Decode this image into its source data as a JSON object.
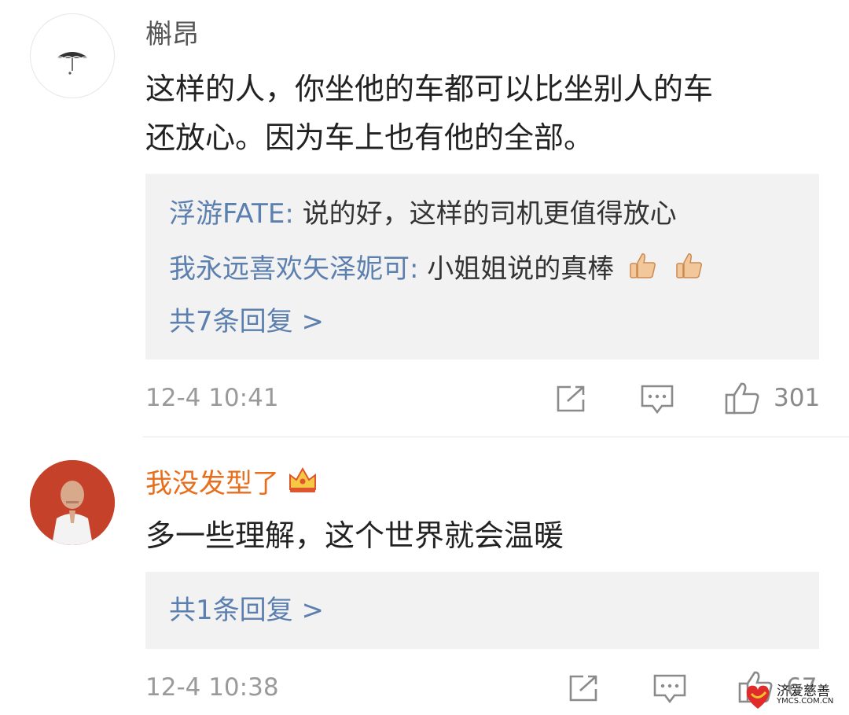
{
  "comments": [
    {
      "username": "槲昂",
      "text_line1": "这样的人，你坐他的车都可以比坐别人的车",
      "text_line2": "还放心。因为车上也有他的全部。",
      "replies": [
        {
          "name": "浮游FATE",
          "sep": ": ",
          "text": "说的好，这样的司机更值得放心"
        },
        {
          "name": "我永远喜欢矢泽妮可",
          "sep": ": ",
          "text": "小姐姐说的真棒"
        }
      ],
      "more_replies": "共7条回复 >",
      "timestamp": "12-4 10:41",
      "like_count": "301"
    },
    {
      "username": "我没发型了",
      "text_line1": "多一些理解，这个世界就会温暖",
      "more_replies": "共1条回复 >",
      "timestamp": "12-4 10:38",
      "like_count": "67"
    }
  ],
  "watermark": {
    "line1": "济爱慈善",
    "line2": "YMCS.COM.CN"
  },
  "colors": {
    "link": "#5b7fae",
    "vip_name": "#e86e1c",
    "reply_bg": "#f2f2f2",
    "meta": "#9a9a9a"
  },
  "icons": [
    "umbrella-icon",
    "share-icon",
    "comment-icon",
    "like-icon",
    "thumbs-up-emoji",
    "crown-icon",
    "heart-logo-icon"
  ]
}
